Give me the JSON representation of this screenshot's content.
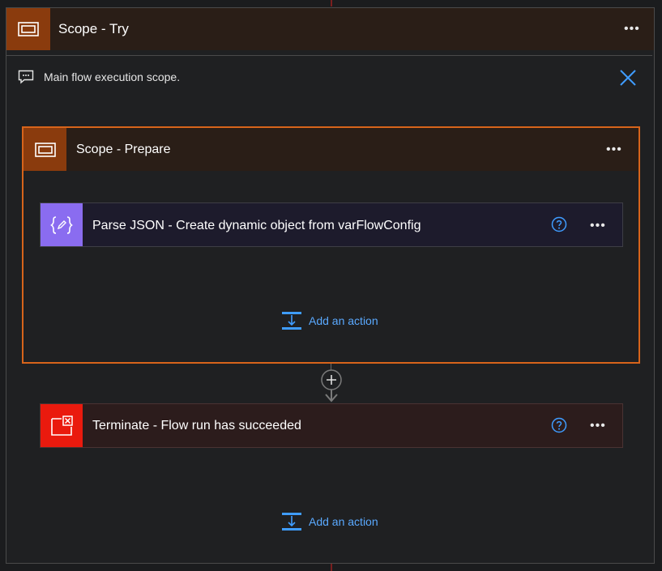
{
  "outer_scope": {
    "title": "Scope - Try",
    "icon": "scope-icon",
    "more_label": "•••",
    "comment": "Main flow execution scope.",
    "comment_icon": "comment-icon",
    "close_icon": "close-icon"
  },
  "inner_scope": {
    "title": "Scope - Prepare",
    "icon": "scope-icon",
    "more_label": "•••",
    "actions": [
      {
        "title": "Parse JSON - Create dynamic object from varFlowConfig",
        "icon": "parse-json-icon",
        "color": "#8a6cf0",
        "more_label": "•••"
      }
    ],
    "add_action_label": "Add an action"
  },
  "terminate": {
    "title": "Terminate - Flow run has succeeded",
    "icon": "terminate-icon",
    "color": "#ea1a0e",
    "more_label": "•••"
  },
  "add_action_label": "Add an action",
  "colors": {
    "scope_accent": "#8a3b0d",
    "selected_border": "#d7641b",
    "link": "#5aa9ff"
  }
}
